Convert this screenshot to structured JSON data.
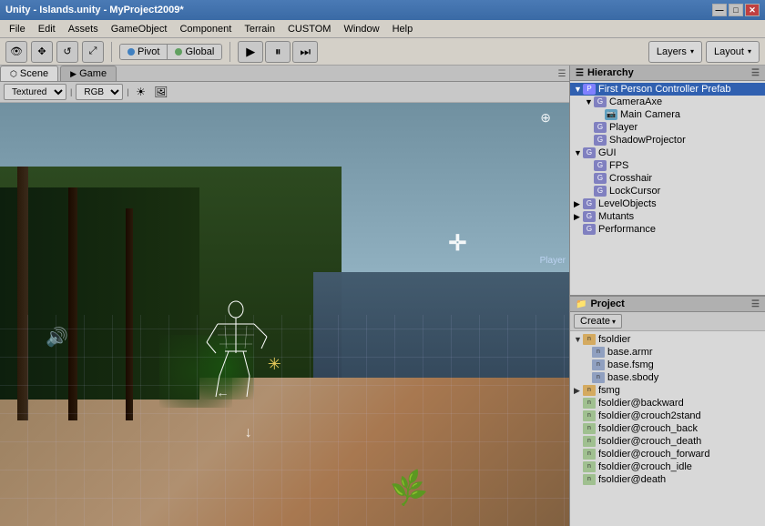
{
  "title_bar": {
    "title": "Unity - Islands.unity - MyProject2009*",
    "minimize_label": "—",
    "maximize_label": "□",
    "close_label": "✕"
  },
  "menu_bar": {
    "items": [
      "File",
      "Edit",
      "Assets",
      "GameObject",
      "Component",
      "Terrain",
      "CUSTOM",
      "Window",
      "Help"
    ]
  },
  "toolbar": {
    "eye_icon": "👁",
    "hand_icon": "✥",
    "rotate_icon": "↺",
    "scale_icon": "⤢",
    "pivot_label": "Pivot",
    "global_label": "Global",
    "play_icon": "▶",
    "pause_icon": "⏸",
    "step_icon": "⏭",
    "layers_label": "Layers",
    "layers_arrow": "▾",
    "layout_label": "Layout",
    "layout_arrow": "▾"
  },
  "viewport": {
    "scene_tab": "Scene",
    "game_tab": "Game",
    "render_mode": "Textured",
    "color_mode": "RGB",
    "player_label": "Player"
  },
  "hierarchy": {
    "title": "Hierarchy",
    "items": [
      {
        "label": "First Person Controller Prefab",
        "indent": 0,
        "expanded": true,
        "selected": true,
        "type": "prefab"
      },
      {
        "label": "CameraAxe",
        "indent": 1,
        "expanded": true,
        "type": "obj"
      },
      {
        "label": "Main Camera",
        "indent": 2,
        "expanded": false,
        "type": "obj"
      },
      {
        "label": "Player",
        "indent": 1,
        "expanded": false,
        "type": "obj"
      },
      {
        "label": "ShadowProjector",
        "indent": 1,
        "expanded": false,
        "type": "obj"
      },
      {
        "label": "GUI",
        "indent": 0,
        "expanded": true,
        "type": "obj"
      },
      {
        "label": "FPS",
        "indent": 1,
        "expanded": false,
        "type": "obj"
      },
      {
        "label": "Crosshair",
        "indent": 1,
        "expanded": false,
        "type": "obj"
      },
      {
        "label": "LockCursor",
        "indent": 1,
        "expanded": false,
        "type": "obj"
      },
      {
        "label": "LevelObjects",
        "indent": 0,
        "expanded": false,
        "type": "folder"
      },
      {
        "label": "Mutants",
        "indent": 0,
        "expanded": false,
        "type": "folder"
      },
      {
        "label": "Performance",
        "indent": 0,
        "expanded": false,
        "type": "obj"
      }
    ]
  },
  "project": {
    "title": "Project",
    "create_label": "Create",
    "items": [
      {
        "label": "fsoldier",
        "indent": 0,
        "expanded": true,
        "type": "folder"
      },
      {
        "label": "base.armr",
        "indent": 1,
        "expanded": false,
        "type": "model"
      },
      {
        "label": "base.fsmg",
        "indent": 1,
        "expanded": false,
        "type": "model"
      },
      {
        "label": "base.sbody",
        "indent": 1,
        "expanded": false,
        "type": "model"
      },
      {
        "label": "fsmg",
        "indent": 0,
        "expanded": false,
        "type": "folder"
      },
      {
        "label": "fsoldier@backward",
        "indent": 0,
        "expanded": false,
        "type": "anim"
      },
      {
        "label": "fsoldier@crouch2stand",
        "indent": 0,
        "expanded": false,
        "type": "anim"
      },
      {
        "label": "fsoldier@crouch_back",
        "indent": 0,
        "expanded": false,
        "type": "anim"
      },
      {
        "label": "fsoldier@crouch_death",
        "indent": 0,
        "expanded": false,
        "type": "anim"
      },
      {
        "label": "fsoldier@crouch_forward",
        "indent": 0,
        "expanded": false,
        "type": "anim"
      },
      {
        "label": "fsoldier@crouch_idle",
        "indent": 0,
        "expanded": false,
        "type": "anim"
      },
      {
        "label": "fsoldier@death",
        "indent": 0,
        "expanded": false,
        "type": "anim"
      }
    ]
  }
}
